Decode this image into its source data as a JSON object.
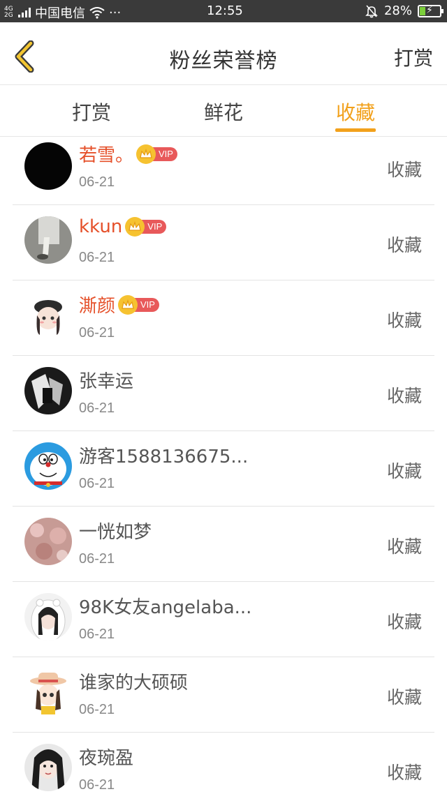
{
  "status_bar": {
    "network": "4G",
    "network2": "2G",
    "carrier": "中国电信",
    "dots": "···",
    "time": "12:55",
    "battery": "28%",
    "battery_level": 0.28
  },
  "header": {
    "title": "粉丝荣誉榜",
    "action_label": "打赏",
    "back_icon": "chevron-left-icon"
  },
  "tabs": [
    {
      "label": "打赏",
      "active": false
    },
    {
      "label": "鲜花",
      "active": false
    },
    {
      "label": "收藏",
      "active": true
    }
  ],
  "colors": {
    "accent": "#f2a11c",
    "vip_name": "#e5502a",
    "vip_tag": "#e8595a",
    "crown": "#f6c230"
  },
  "vip_label": "VIP",
  "items": [
    {
      "name": "若雪。",
      "date": "06-21",
      "action": "收藏",
      "vip": true
    },
    {
      "name": "kkun",
      "date": "06-21",
      "action": "收藏",
      "vip": true
    },
    {
      "name": "澌颜",
      "date": "06-21",
      "action": "收藏",
      "vip": true
    },
    {
      "name": "张幸运",
      "date": "06-21",
      "action": "收藏",
      "vip": false
    },
    {
      "name": "游客1588136675...",
      "date": "06-21",
      "action": "收藏",
      "vip": false
    },
    {
      "name": "一恍如梦",
      "date": "06-21",
      "action": "收藏",
      "vip": false
    },
    {
      "name": "98K女友angelaba...",
      "date": "06-21",
      "action": "收藏",
      "vip": false
    },
    {
      "name": "谁家的大硕硕",
      "date": "06-21",
      "action": "收藏",
      "vip": false
    },
    {
      "name": "夜琬盈",
      "date": "06-21",
      "action": "收藏",
      "vip": false
    }
  ]
}
